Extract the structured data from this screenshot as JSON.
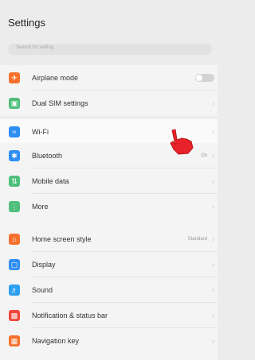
{
  "header": {
    "title": "Settings"
  },
  "search": {
    "placeholder": "Search for setting"
  },
  "colors": {
    "airplane": "#f6702d",
    "dual_sim": "#4fbf7c",
    "wifi": "#2e8ef2",
    "bluetooth": "#2e8ef2",
    "mobile_data": "#4fbf7c",
    "more": "#4fbf7c",
    "home_screen": "#f6702d",
    "display": "#2e8ef2",
    "sound": "#2ea0f2",
    "notification": "#f0463a",
    "navigation": "#f6702d",
    "cursor": "#e8222a"
  },
  "items": {
    "airplane": {
      "label": "Airplane mode",
      "icon": "airplane-icon",
      "toggle": false
    },
    "dual_sim": {
      "label": "Dual SIM settings",
      "icon": "sim-card-icon"
    },
    "wifi": {
      "label": "Wi-Fi",
      "icon": "wifi-icon"
    },
    "bluetooth": {
      "label": "Bluetooth",
      "value": "On",
      "icon": "bluetooth-icon"
    },
    "mobile_data": {
      "label": "Mobile data",
      "icon": "mobile-data-icon"
    },
    "more": {
      "label": "More",
      "icon": "more-icon"
    },
    "home_screen": {
      "label": "Home screen style",
      "value": "Standard",
      "icon": "home-icon"
    },
    "display": {
      "label": "Display",
      "icon": "display-icon"
    },
    "sound": {
      "label": "Sound",
      "icon": "speaker-icon"
    },
    "notification": {
      "label": "Notification & status bar",
      "icon": "notification-icon"
    },
    "navigation": {
      "label": "Navigation key",
      "icon": "navigation-key-icon"
    }
  }
}
